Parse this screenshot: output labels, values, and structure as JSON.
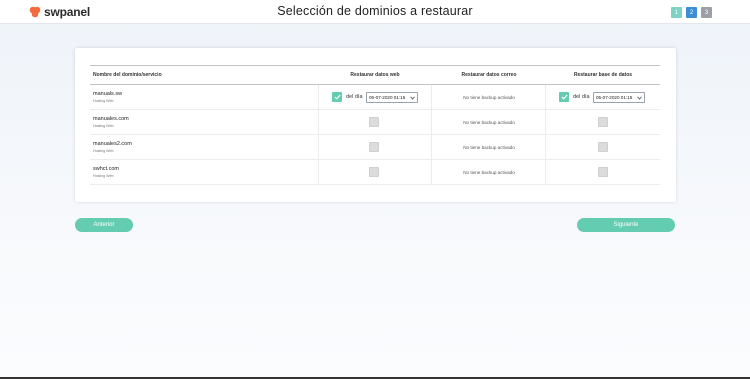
{
  "header": {
    "logo_text": "swpanel",
    "title": "Selección de dominios a restaurar",
    "steps": [
      "1",
      "2",
      "3"
    ],
    "active_step": 2
  },
  "table": {
    "headers": [
      "Nombre del dominio/servicio",
      "Restaurar datos web",
      "Restaurar datos correo",
      "Restaurar base de datos"
    ],
    "rows": [
      {
        "name": "manuals.sw",
        "type": "Hosting Web",
        "web_checked": true,
        "web_prefix": "del día",
        "web_date": "05-07-2020 01:15",
        "mail_text": "No tiene backup activado",
        "db_checked": true,
        "db_prefix": "del día",
        "db_date": "05-07-2020 01:15"
      },
      {
        "name": "manuales.com",
        "type": "Hosting Web",
        "web_checked": false,
        "mail_text": "No tiene backup activado",
        "db_checked": false
      },
      {
        "name": "manuales2.com",
        "type": "Hosting Web",
        "web_checked": false,
        "mail_text": "No tiene backup activado",
        "db_checked": false
      },
      {
        "name": "swhct.com",
        "type": "Hosting Web",
        "web_checked": false,
        "mail_text": "No tiene backup activado",
        "db_checked": false
      }
    ]
  },
  "buttons": {
    "prev": "Anterior",
    "next": "Siguiente"
  },
  "colors": {
    "accent": "#64ccb1",
    "step_active": "#3c8fd6",
    "step_done": "#7fd3c2",
    "step_pending": "#9aa0a6",
    "brand": "#f26a3d"
  }
}
